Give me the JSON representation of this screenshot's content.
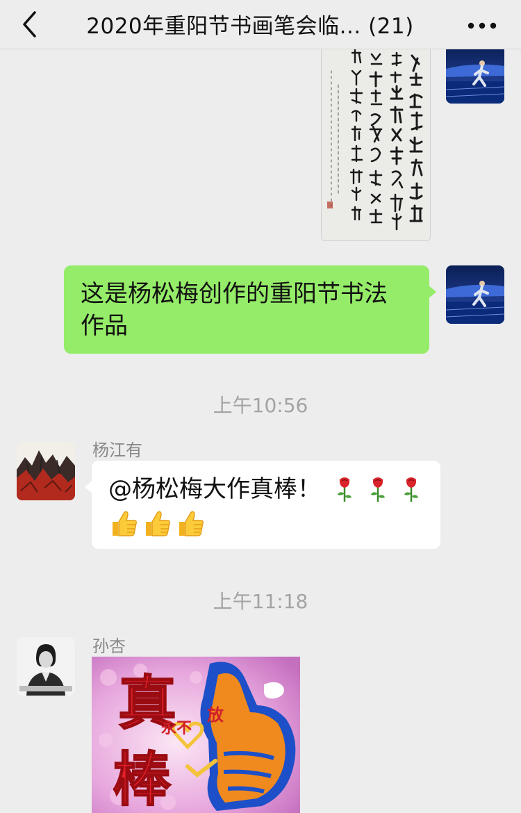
{
  "header": {
    "title": "2020年重阳节书画笔会临... (21)",
    "back_icon": "chevron-left-icon",
    "more_icon": "more-dots-icon"
  },
  "messages": [
    {
      "type": "image",
      "direction": "outgoing",
      "content": "calligraphy-artwork"
    },
    {
      "type": "text",
      "direction": "outgoing",
      "text": "这是杨松梅创作的重阳节书法作品",
      "lines": [
        "这是杨松梅创作的重阳节书法",
        "作品"
      ]
    },
    {
      "type": "timestamp",
      "text": "上午10:56"
    },
    {
      "type": "text",
      "direction": "incoming",
      "sender": "杨江有",
      "text": "@杨松梅大作真棒！🌹🌹🌹👍👍👍",
      "line1": "@杨松梅大作真棒！",
      "line1_emoji": [
        "rose-emoji",
        "rose-emoji",
        "rose-emoji"
      ],
      "line2_emoji": [
        "thumbs-up-emoji",
        "thumbs-up-emoji",
        "thumbs-up-emoji"
      ]
    },
    {
      "type": "timestamp",
      "text": "上午11:18"
    },
    {
      "type": "sticker",
      "direction": "incoming",
      "sender": "孙杏",
      "sticker_text": {
        "big1": "真",
        "big2": "棒",
        "small1": "永不",
        "small2": "放"
      }
    }
  ],
  "colors": {
    "background": "#ededed",
    "outgoing_bubble": "#95ec69",
    "incoming_bubble": "#ffffff",
    "timestamp_text": "#a3a3a3",
    "sender_text": "#888888"
  }
}
